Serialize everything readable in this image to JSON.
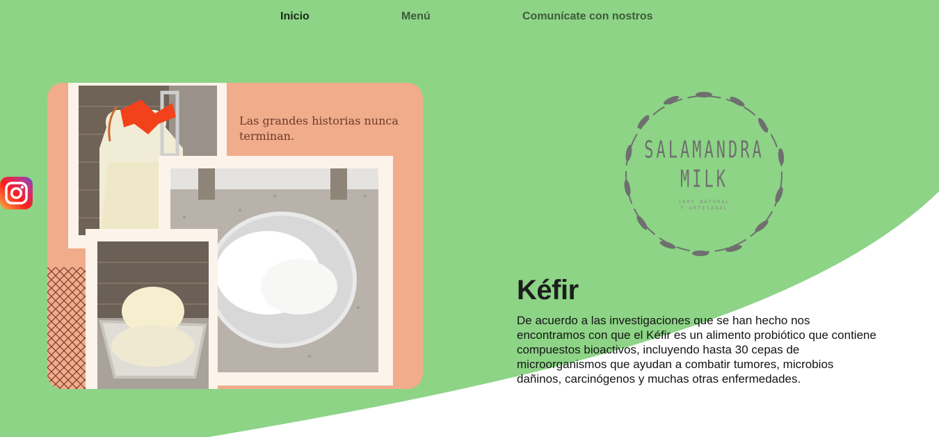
{
  "nav": {
    "items": [
      {
        "label": "Inicio"
      },
      {
        "label": "Menú"
      },
      {
        "label": "Comunícate con nostros"
      }
    ]
  },
  "social": {
    "icon": "instagram-icon"
  },
  "collage": {
    "caption": "Las grandes historias nunca terminan.",
    "photos": [
      "kefir-bottle-photo",
      "kefir-bowl-photo",
      "kefir-grains-photo"
    ]
  },
  "logo": {
    "line1": "SALAMANDRA",
    "line2": "MILK",
    "tagline": "100% NATURAL\nY ARTESANAL"
  },
  "article": {
    "title": "Kéfir",
    "body": "De acuerdo a las investigaciones que se han hecho nos encontramos con que el Kéfir es un alimento probiótico que contiene compuestos bioactivos, incluyendo hasta 30 cepas de microorganismos que ayudan a combatir tumores, microbios dañinos, carcinógenos y muchas otras enfermedades."
  },
  "colors": {
    "background": "#8dd486",
    "curve": "#ffffff",
    "collage": "#f1ac8b",
    "frame": "#fcf3ea"
  }
}
